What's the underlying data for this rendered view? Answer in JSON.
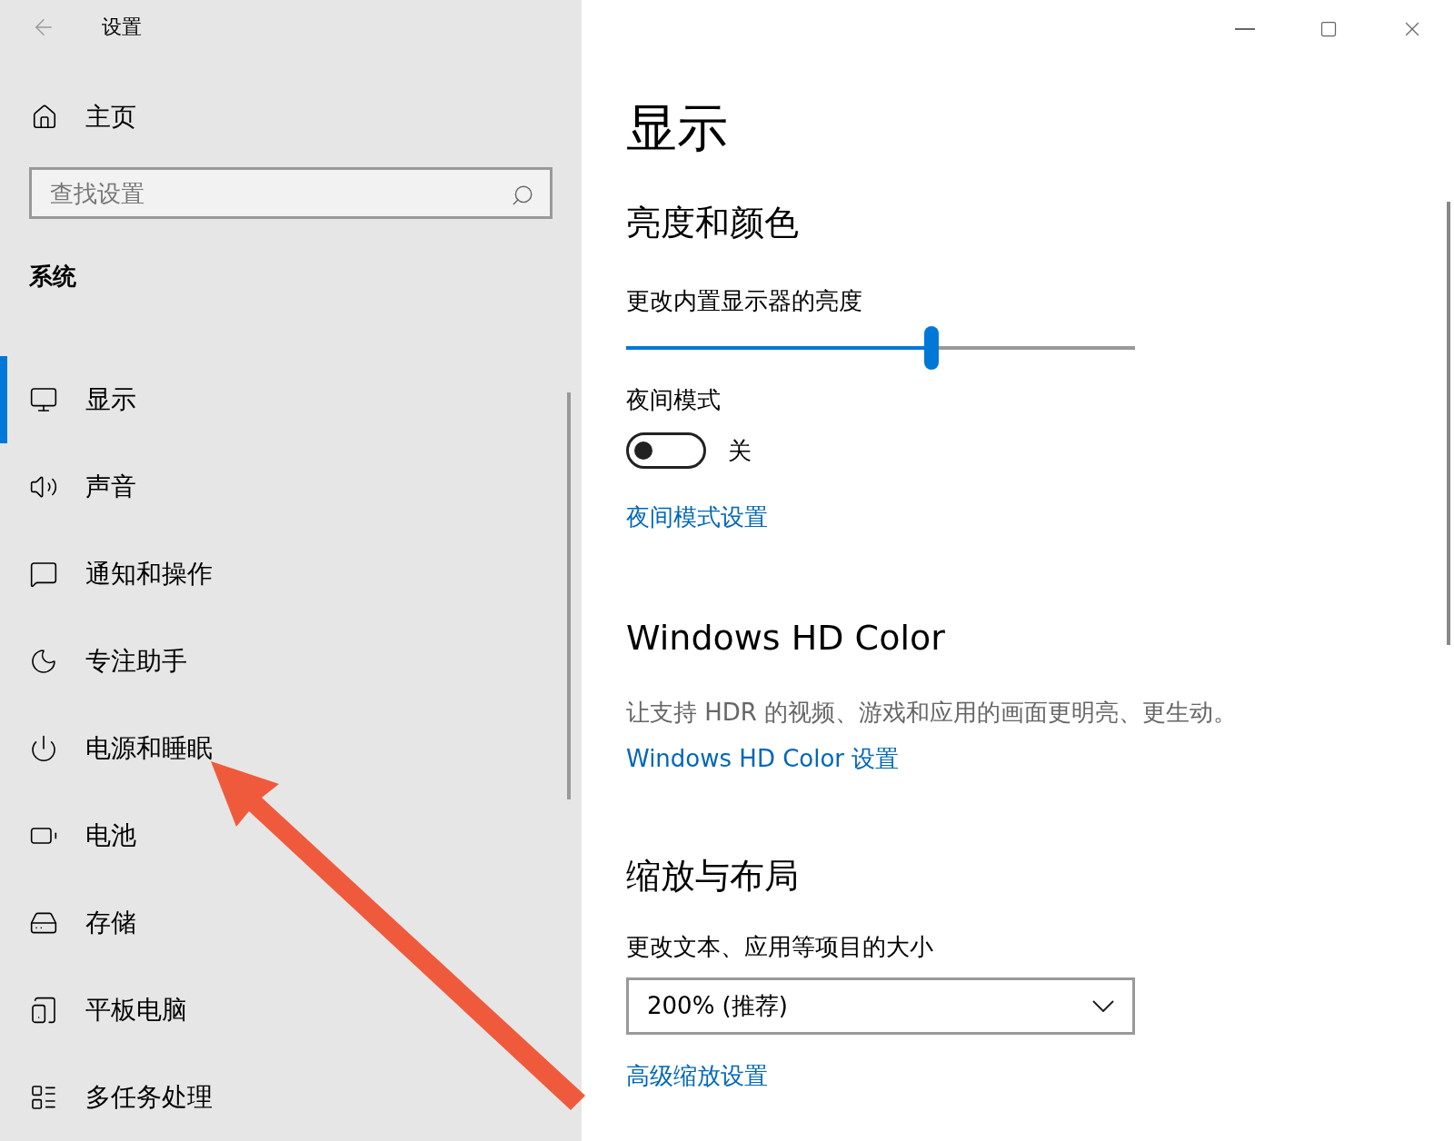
{
  "window": {
    "title": "设置"
  },
  "sidebar": {
    "home": "主页",
    "search": {
      "placeholder": "查找设置"
    },
    "section": "系统",
    "items": [
      {
        "kind": "display",
        "label": "显示",
        "selected": true
      },
      {
        "kind": "sound",
        "label": "声音",
        "selected": false
      },
      {
        "kind": "notify",
        "label": "通知和操作",
        "selected": false
      },
      {
        "kind": "focus",
        "label": "专注助手",
        "selected": false
      },
      {
        "kind": "power",
        "label": "电源和睡眠",
        "selected": false
      },
      {
        "kind": "battery",
        "label": "电池",
        "selected": false
      },
      {
        "kind": "storage",
        "label": "存储",
        "selected": false
      },
      {
        "kind": "tablet",
        "label": "平板电脑",
        "selected": false
      },
      {
        "kind": "multitask",
        "label": "多任务处理",
        "selected": false
      }
    ]
  },
  "main": {
    "title": "显示",
    "brightness": {
      "heading": "亮度和颜色",
      "label": "更改内置显示器的亮度",
      "level": 0.6
    },
    "night": {
      "label": "夜间模式",
      "on": false,
      "state": "关",
      "link": "夜间模式设置"
    },
    "hd": {
      "heading": "Windows HD Color",
      "description": "让支持 HDR 的视频、游戏和应用的画面更明亮、更生动。",
      "link": "Windows HD Color 设置"
    },
    "scale": {
      "heading": "缩放与布局",
      "label": "更改文本、应用等项目的大小",
      "value": "200% (推荐)",
      "link": "高级缩放设置"
    }
  }
}
